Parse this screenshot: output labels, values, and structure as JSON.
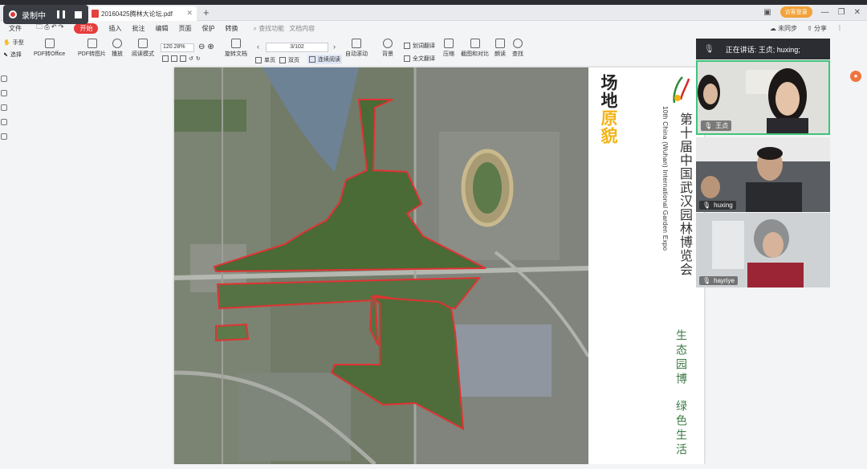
{
  "recorder": {
    "label": "录制中"
  },
  "tab": {
    "title": "20160425腾林大论坛.pdf"
  },
  "window": {
    "login_label": "访客登录"
  },
  "menu": {
    "file": "文件",
    "items": [
      "开始",
      "插入",
      "批注",
      "编辑",
      "页面",
      "保护",
      "转换"
    ],
    "search_placeholder": "查找功能",
    "doc_content": "文档内容",
    "sync": "未同步",
    "share": "分享"
  },
  "toolbar": {
    "hand": "手型",
    "select": "选择",
    "pdf_office": "PDF转Office",
    "pdf_image": "PDF转图片",
    "play": "播放",
    "read_mode": "阅读模式",
    "zoom": "120.28%",
    "rotate": "旋转文档",
    "page": "3/102",
    "single": "单页",
    "double": "双页",
    "continuous": "连续阅读",
    "auto_scroll": "自动滚动",
    "background": "背景",
    "translate": "划词翻译",
    "full_translate": "全文翻译",
    "compress": "压缩",
    "screenshot": "截图和对比",
    "read_aloud": "朗读",
    "find": "查找"
  },
  "page": {
    "title_black": "场地",
    "title_yellow": "原貌",
    "expo_cn": "第十届中国武汉园林博览会",
    "expo_en": "10th China (Wuhan) International Garden Expo",
    "slogan1": "生态园博",
    "slogan2": "绿色生活"
  },
  "meeting": {
    "speaking": "正在讲话: 王贞; huxing;",
    "participants": [
      {
        "name": "王贞"
      },
      {
        "name": "huxing"
      },
      {
        "name": "hayriye"
      }
    ]
  },
  "colors": {
    "accent_red": "#e83b3b",
    "title_yellow": "#f2b417",
    "speaker_border": "#3fc47b"
  }
}
